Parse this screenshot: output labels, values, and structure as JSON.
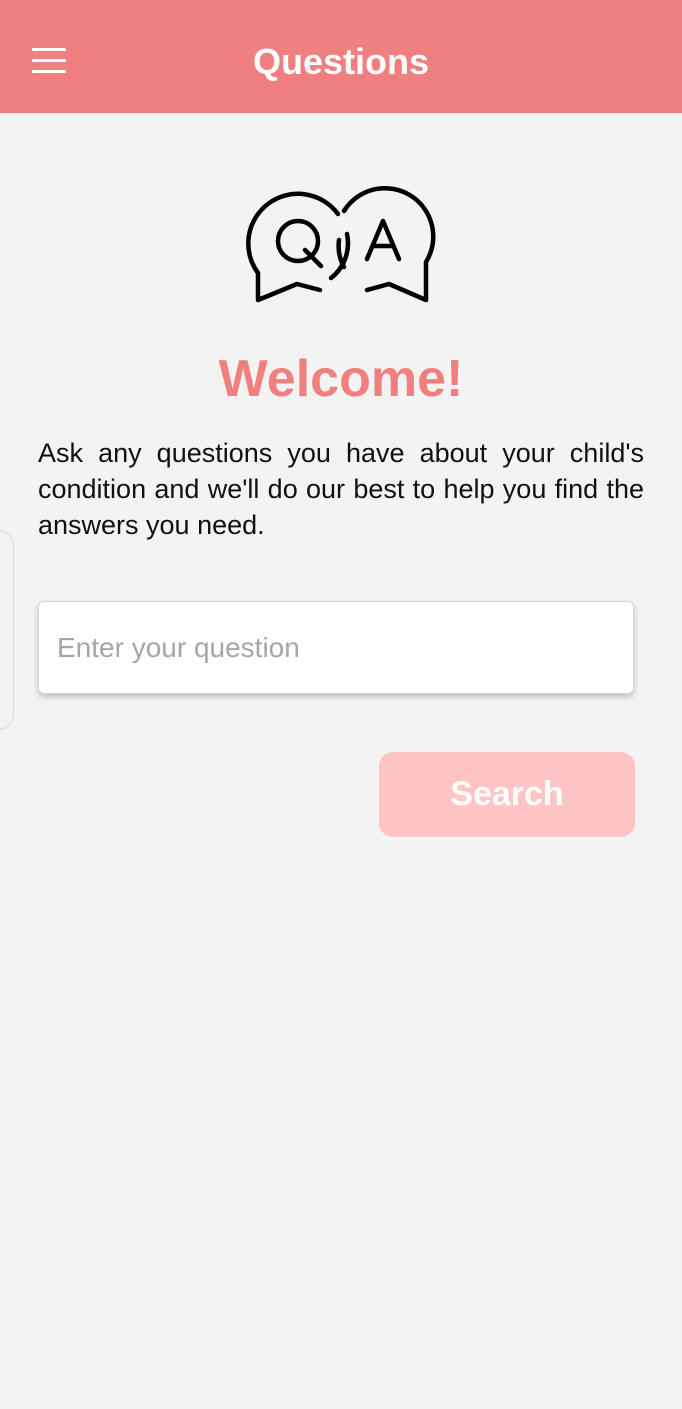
{
  "app_bar": {
    "title": "Questions",
    "menu_icon": "hamburger-menu-icon",
    "background": "#f08080"
  },
  "hero": {
    "logo_icon": "qa-speech-bubbles-icon",
    "logo_letters": [
      "Q",
      "A"
    ],
    "welcome": "Welcome!",
    "intro": "Ask any questions you have about your child's condition and we'll do our best to help you find the answers you need."
  },
  "question_form": {
    "placeholder": "Enter your question",
    "value": "",
    "search_label": "Search"
  },
  "colors": {
    "accent": "#f08080",
    "button_disabled": "#ffc5c5",
    "background": "#f2f3f2"
  }
}
